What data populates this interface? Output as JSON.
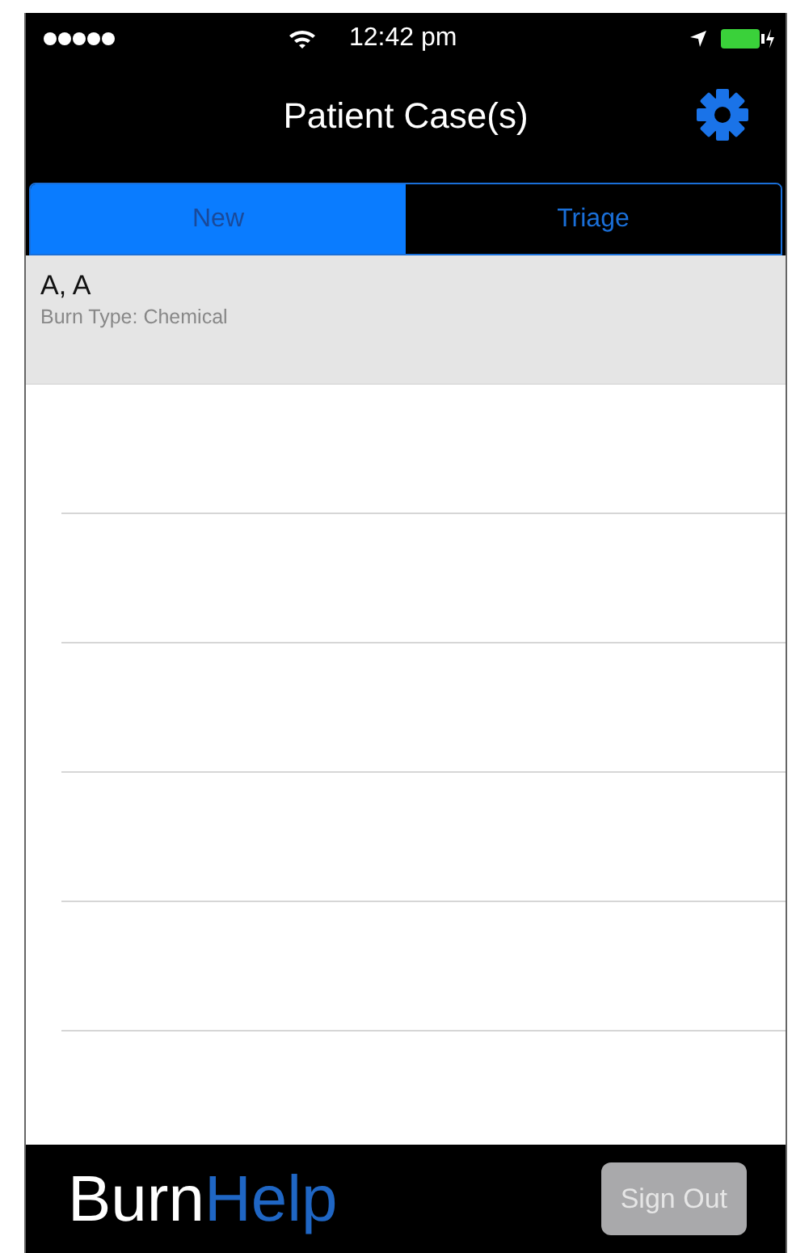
{
  "status_bar": {
    "time": "12:42 pm"
  },
  "nav_bar": {
    "title": "Patient Case(s)"
  },
  "tabs": [
    {
      "label": "New",
      "selected": true
    },
    {
      "label": "Triage",
      "selected": false
    }
  ],
  "cases": [
    {
      "name": "A, A",
      "detail": "Burn Type: Chemical",
      "selected": true
    }
  ],
  "footer": {
    "logo_first": "Burn",
    "logo_second": "Help",
    "button": "Sign Out",
    "button_disabled": true
  }
}
